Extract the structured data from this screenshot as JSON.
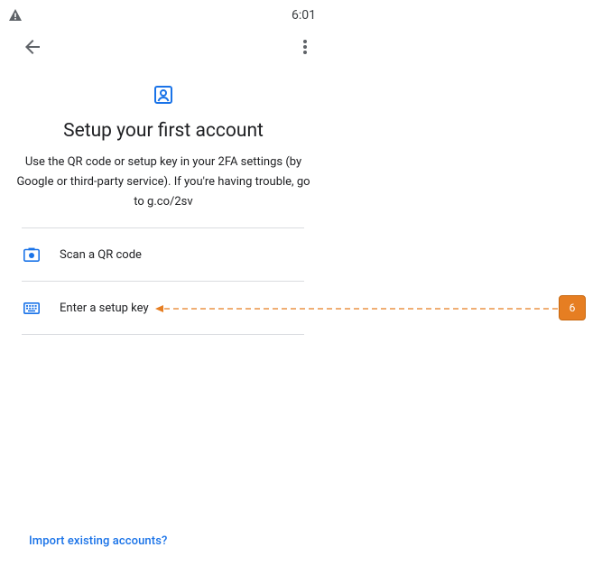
{
  "status_bar": {
    "time": "6:01",
    "alert_icon": "warning-triangle-icon"
  },
  "app_bar": {
    "back_icon": "arrow-back-icon",
    "menu_icon": "more-vert-icon"
  },
  "header": {
    "icon": "account-box-icon",
    "title": "Setup your first account",
    "description": "Use the QR code or setup key in your 2FA settings (by Google or third-party service). If you're having trouble, go to g.co/2sv"
  },
  "options": [
    {
      "label": "Scan a QR code",
      "icon": "camera-icon"
    },
    {
      "label": "Enter a setup key",
      "icon": "keyboard-icon"
    }
  ],
  "footer": {
    "import_link": "Import existing accounts?"
  },
  "annotation": {
    "badge": "6"
  },
  "colors": {
    "accent": "#1a73e8",
    "text": "#202124",
    "divider": "#dadce0",
    "annotation": "#e67e22"
  }
}
